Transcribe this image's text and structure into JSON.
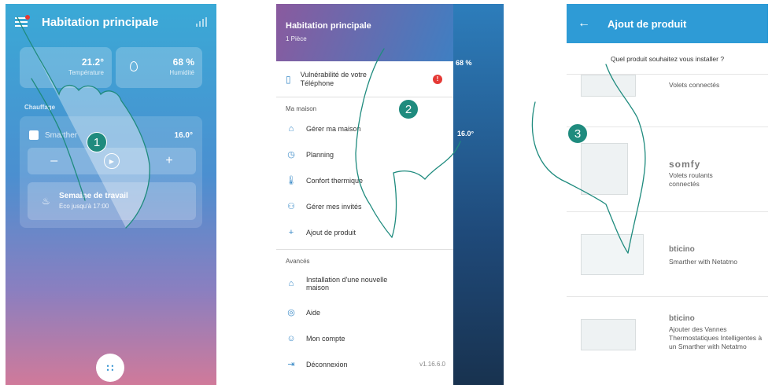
{
  "screen1": {
    "title": "Habitation principale",
    "temp_value": "21.2°",
    "temp_label": "Température",
    "humidity_value": "68 %",
    "humidity_label": "Humidité",
    "section_label": "Chauffage",
    "device_name": "Smarther",
    "device_temp": "16.0°",
    "minus": "–",
    "plus": "+",
    "program_title": "Semaine de travail",
    "program_sub": "Éco jusqu'à 17:00",
    "fab": "∷"
  },
  "screen2": {
    "home_name": "Habitation principale",
    "rooms": "1 Pièce",
    "warning_text": "Vulnérabilité de votre Téléphone",
    "warning_badge": "!",
    "section_home": "Ma maison",
    "items": [
      {
        "icon": "⌂",
        "label": "Gérer ma maison"
      },
      {
        "icon": "◷",
        "label": "Planning"
      },
      {
        "icon": "🌡",
        "label": "Confort thermique"
      },
      {
        "icon": "⚇",
        "label": "Gérer mes invités"
      },
      {
        "icon": "+",
        "label": "Ajout de produit"
      }
    ],
    "section_advanced": "Avancés",
    "advanced_items": [
      {
        "icon": "⌂",
        "label": "Installation d'une nouvelle maison"
      },
      {
        "icon": "◎",
        "label": "Aide"
      },
      {
        "icon": "☺",
        "label": "Mon compte"
      },
      {
        "icon": "⇥",
        "label": "Déconnexion"
      }
    ],
    "version": "v1.16.6.0",
    "peek_humidity": "68 %",
    "peek_temp": "16.0°"
  },
  "screen3": {
    "title": "Ajout de produit",
    "back": "←",
    "question": "Quel produit souhaitez vous installer ?",
    "products": [
      {
        "brand": "",
        "desc": "Volets connectés"
      },
      {
        "brand": "somfy",
        "desc": "Volets roulants connectés"
      },
      {
        "brand": "bticino",
        "desc": "Smarther with Netatmo"
      },
      {
        "brand": "bticino",
        "desc": "Ajouter des Vannes Thermostatiques Intelligentes à un Smarther with Netatmo"
      }
    ]
  },
  "steps": [
    "1",
    "2",
    "3"
  ],
  "colors": {
    "accent": "#2e9bd6",
    "step_badge": "#1f8b7e",
    "alert": "#e53935"
  }
}
